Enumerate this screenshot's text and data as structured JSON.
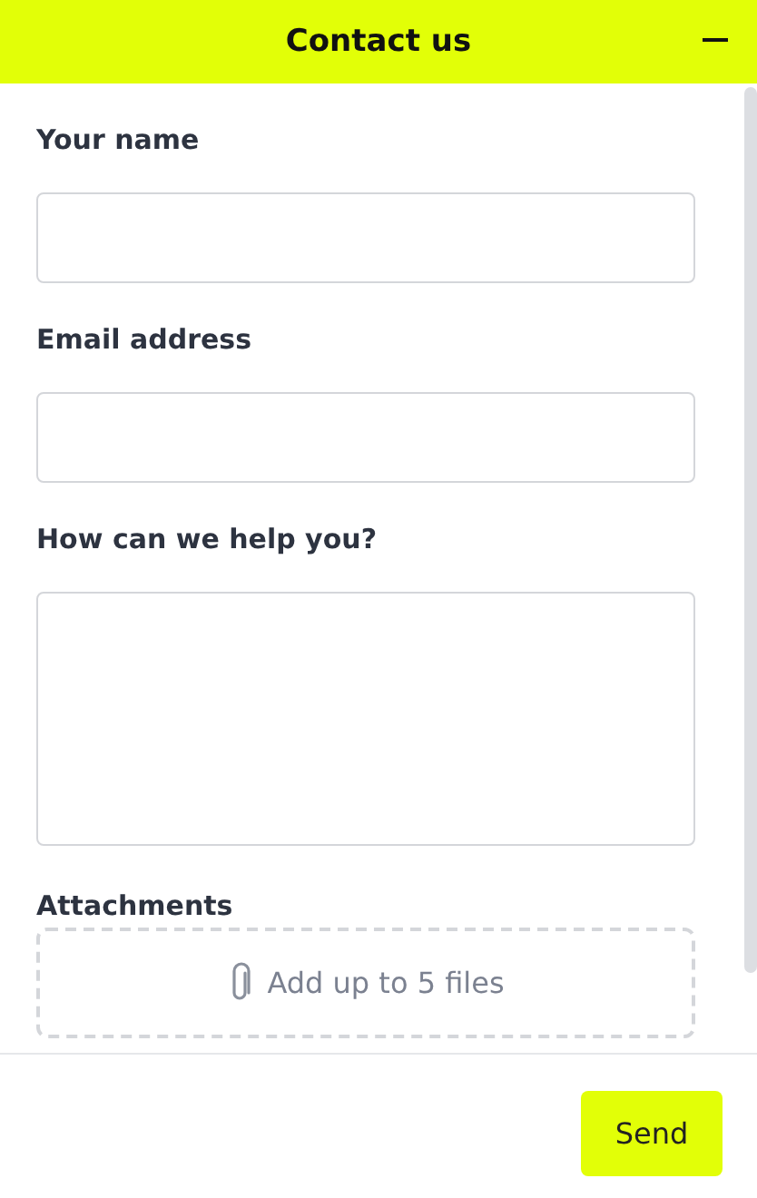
{
  "header": {
    "title": "Contact us"
  },
  "fields": [
    {
      "label": "Your name",
      "kind": "text"
    },
    {
      "label": "Email address",
      "kind": "text"
    },
    {
      "label": "How can we help you?",
      "kind": "textarea"
    }
  ],
  "attachments": {
    "label": "Attachments",
    "hint": "Add up to 5 files"
  },
  "footer": {
    "button": "Send"
  }
}
